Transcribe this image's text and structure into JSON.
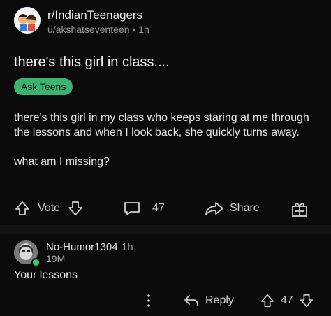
{
  "post": {
    "subreddit": "r/IndianTeenagers",
    "author": "u/akshatseventeen",
    "age": "1h",
    "meta_sep": "•",
    "title": "there's this girl in class....",
    "flair": "Ask Teens",
    "flair_color": "#3cb371",
    "body": [
      "there's this girl in my class who keeps staring at me through the lessons and when I look back, she quickly turns away.",
      "what am I missing?"
    ],
    "actions": {
      "vote_label": "Vote",
      "comment_count": "47",
      "share_label": "Share"
    }
  },
  "comment": {
    "username": "No-Humor1304",
    "age": "1h",
    "user_flair": "19M",
    "body": "Your lessons",
    "reply_label": "Reply",
    "score": "47",
    "online_color": "#2bd46a"
  },
  "icons": [
    "subreddit-avatar",
    "upvote-icon",
    "downvote-icon",
    "comment-icon",
    "share-icon",
    "award-icon",
    "more-icon",
    "reply-icon"
  ]
}
